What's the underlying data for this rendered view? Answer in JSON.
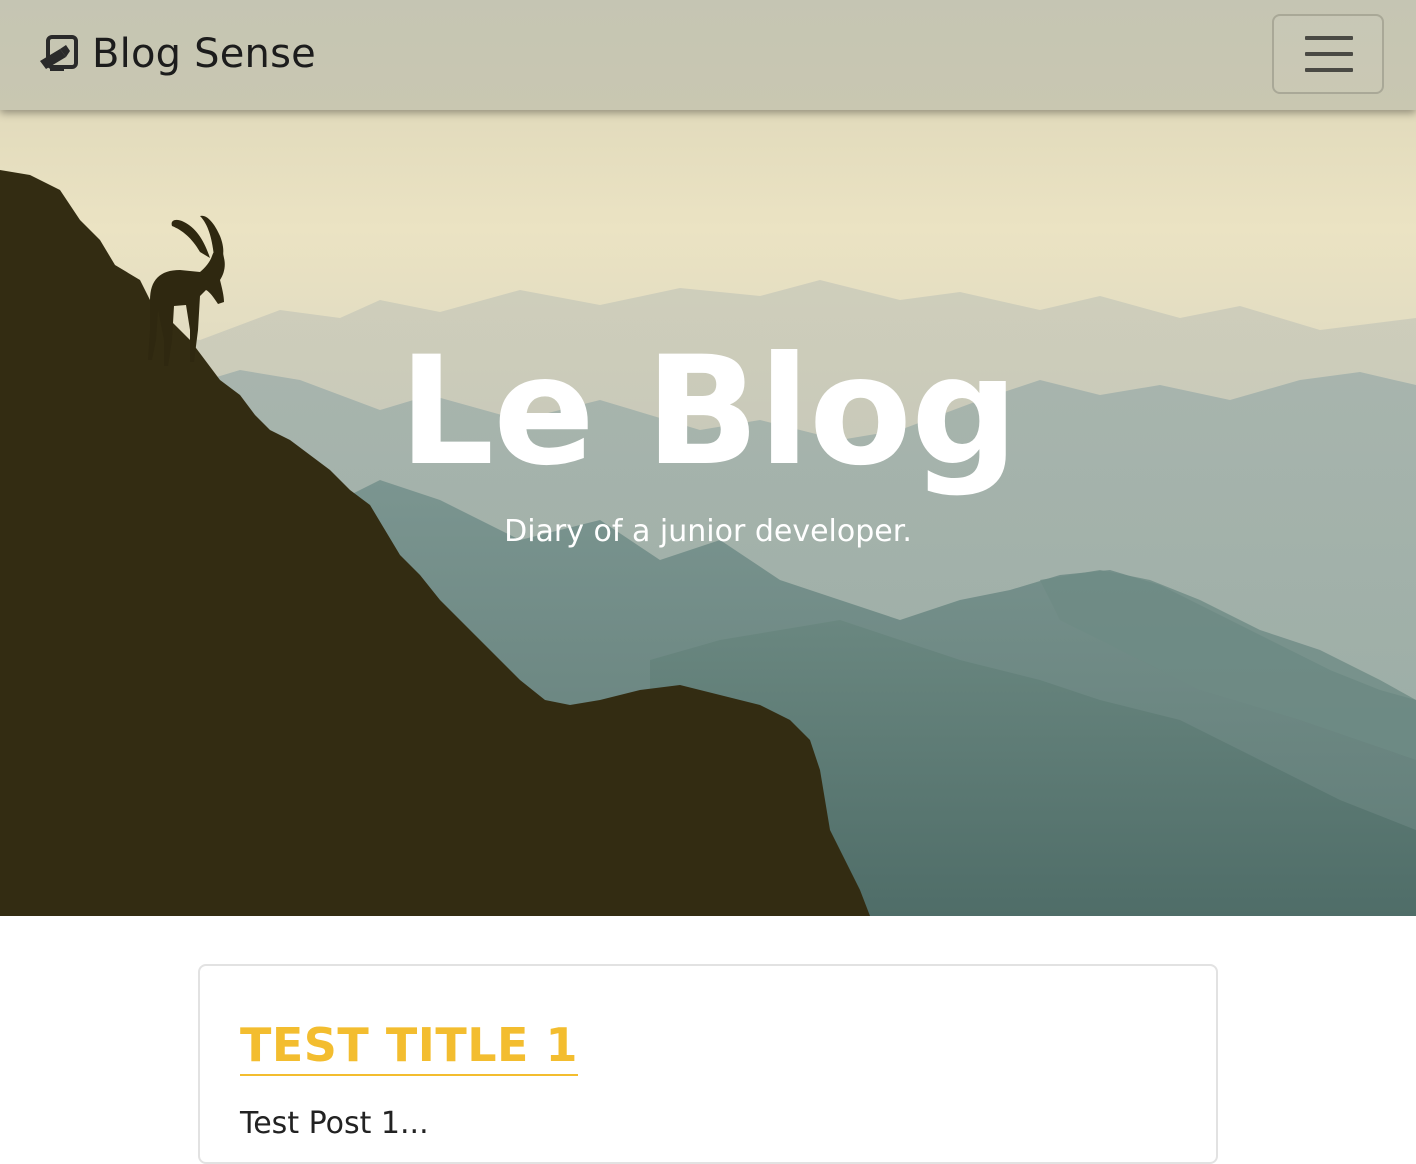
{
  "navbar": {
    "brand_label": "Blog Sense",
    "brand_icon": "pencil-square-icon",
    "menu_icon": "hamburger-menu-icon"
  },
  "hero": {
    "title": "Le Blog",
    "subtitle": "Diary of a junior developer."
  },
  "posts": [
    {
      "title": "TEST TITLE 1",
      "excerpt": "Test Post 1..."
    }
  ],
  "colors": {
    "accent": "#f3bd2f",
    "navbar_bg": "#c7c6b2",
    "hero_text": "#ffffff",
    "silhouette": "#332c12"
  }
}
